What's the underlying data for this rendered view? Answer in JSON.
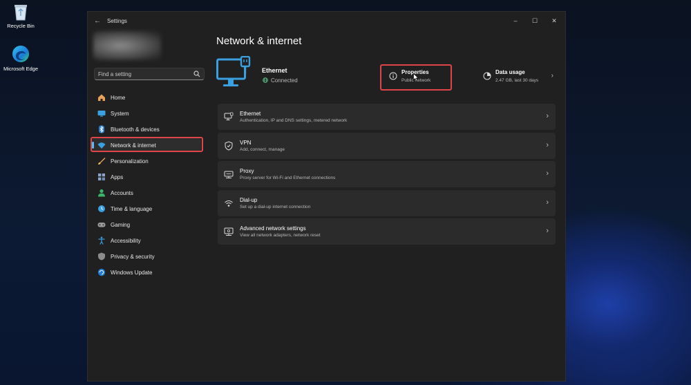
{
  "desktop": {
    "icons": [
      {
        "label": "Recycle Bin",
        "icon": "recycle-bin-icon"
      },
      {
        "label": "Microsoft Edge",
        "icon": "edge-icon"
      }
    ]
  },
  "window": {
    "title": "Settings",
    "controls": [
      "minimize",
      "maximize",
      "close"
    ]
  },
  "sidebar": {
    "search_placeholder": "Find a setting",
    "items": [
      {
        "label": "Home",
        "icon": "home-icon"
      },
      {
        "label": "System",
        "icon": "system-icon"
      },
      {
        "label": "Bluetooth & devices",
        "icon": "bluetooth-icon"
      },
      {
        "label": "Network & internet",
        "icon": "wifi-icon",
        "selected": true
      },
      {
        "label": "Personalization",
        "icon": "brush-icon"
      },
      {
        "label": "Apps",
        "icon": "apps-icon"
      },
      {
        "label": "Accounts",
        "icon": "accounts-icon"
      },
      {
        "label": "Time & language",
        "icon": "time-language-icon"
      },
      {
        "label": "Gaming",
        "icon": "gaming-icon"
      },
      {
        "label": "Accessibility",
        "icon": "accessibility-icon"
      },
      {
        "label": "Privacy & security",
        "icon": "shield-icon"
      },
      {
        "label": "Windows Update",
        "icon": "update-icon"
      }
    ]
  },
  "main": {
    "title": "Network & internet",
    "hero": {
      "name": "Ethernet",
      "status": "Connected",
      "properties": {
        "title": "Properties",
        "subtitle": "Public network"
      },
      "data_usage": {
        "title": "Data usage",
        "subtitle": "2.47 GB, last 30 days"
      }
    },
    "cards": [
      {
        "title": "Ethernet",
        "subtitle": "Authentication, IP and DNS settings, metered network",
        "icon": "ethernet-icon"
      },
      {
        "title": "VPN",
        "subtitle": "Add, connect, manage",
        "icon": "vpn-shield-icon"
      },
      {
        "title": "Proxy",
        "subtitle": "Proxy server for Wi-Fi and Ethernet connections",
        "icon": "proxy-icon"
      },
      {
        "title": "Dial-up",
        "subtitle": "Set up a dial-up internet connection",
        "icon": "dialup-icon"
      },
      {
        "title": "Advanced network settings",
        "subtitle": "View all network adapters, network reset",
        "icon": "advanced-network-icon"
      }
    ]
  },
  "colors": {
    "accent": "#4cc2ff",
    "highlight": "#e0454a",
    "window_bg": "#202020",
    "card_bg": "#2b2b2b"
  }
}
